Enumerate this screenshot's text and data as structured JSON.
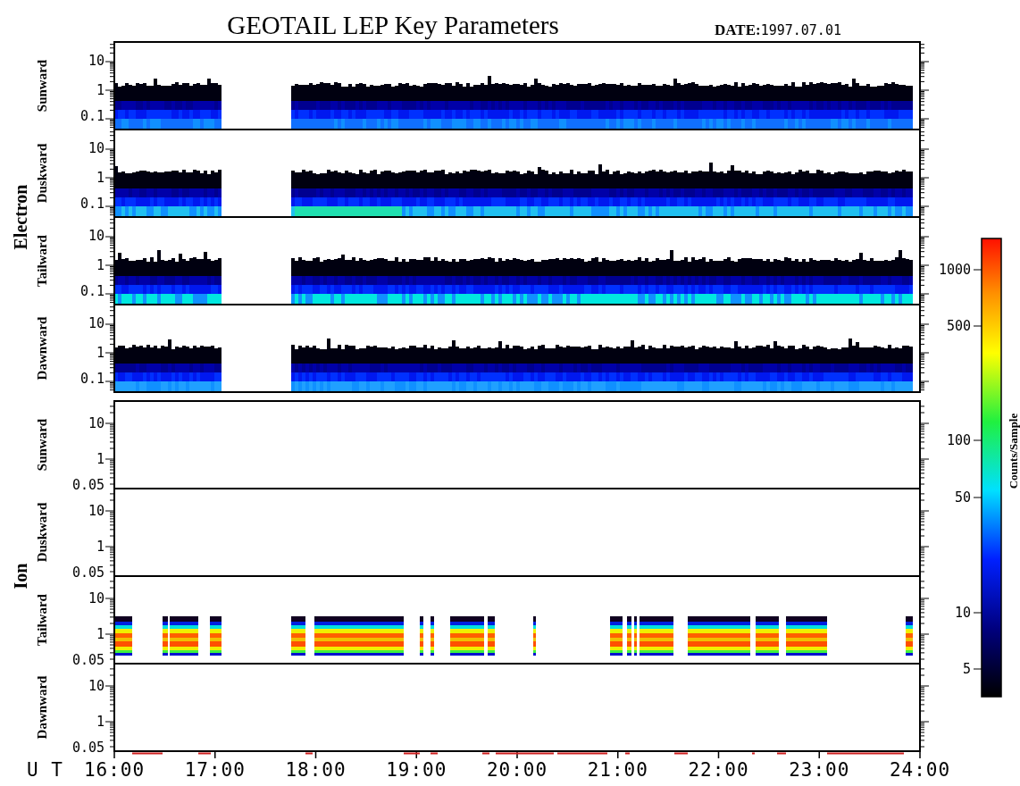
{
  "title": "GEOTAIL LEP Key Parameters",
  "date": {
    "label": "DATE:",
    "value": "1997.07.01"
  },
  "groups": [
    {
      "name": "Electron",
      "panels": [
        {
          "name": "Sunward",
          "kind": "electron",
          "yticks": [
            "10",
            "1",
            "0.1"
          ]
        },
        {
          "name": "Duskward",
          "kind": "electron",
          "yticks": [
            "10",
            "1",
            "0.1"
          ]
        },
        {
          "name": "Tailward",
          "kind": "electron",
          "yticks": [
            "10",
            "1",
            "0.1"
          ]
        },
        {
          "name": "Dawnward",
          "kind": "electron",
          "yticks": [
            "10",
            "1",
            "0.1"
          ]
        }
      ]
    },
    {
      "name": "Ion",
      "panels": [
        {
          "name": "Sunward",
          "kind": "empty",
          "yticks": [
            "10",
            "1",
            "0.05"
          ]
        },
        {
          "name": "Duskward",
          "kind": "empty",
          "yticks": [
            "10",
            "1",
            "0.05"
          ]
        },
        {
          "name": "Tailward",
          "kind": "ion",
          "yticks": [
            "10",
            "1",
            "0.05"
          ]
        },
        {
          "name": "Dawnward",
          "kind": "empty",
          "yticks": [
            "10",
            "1",
            "0.05"
          ]
        }
      ]
    }
  ],
  "x_axis": {
    "label": "U T",
    "ticks": [
      "16:00",
      "17:00",
      "18:00",
      "19:00",
      "20:00",
      "21:00",
      "22:00",
      "23:00",
      "24:00"
    ]
  },
  "colorbar": {
    "title": "Counts/Sample",
    "ticks": [
      "1000",
      "500",
      "100",
      "50",
      "10",
      "5"
    ]
  }
}
